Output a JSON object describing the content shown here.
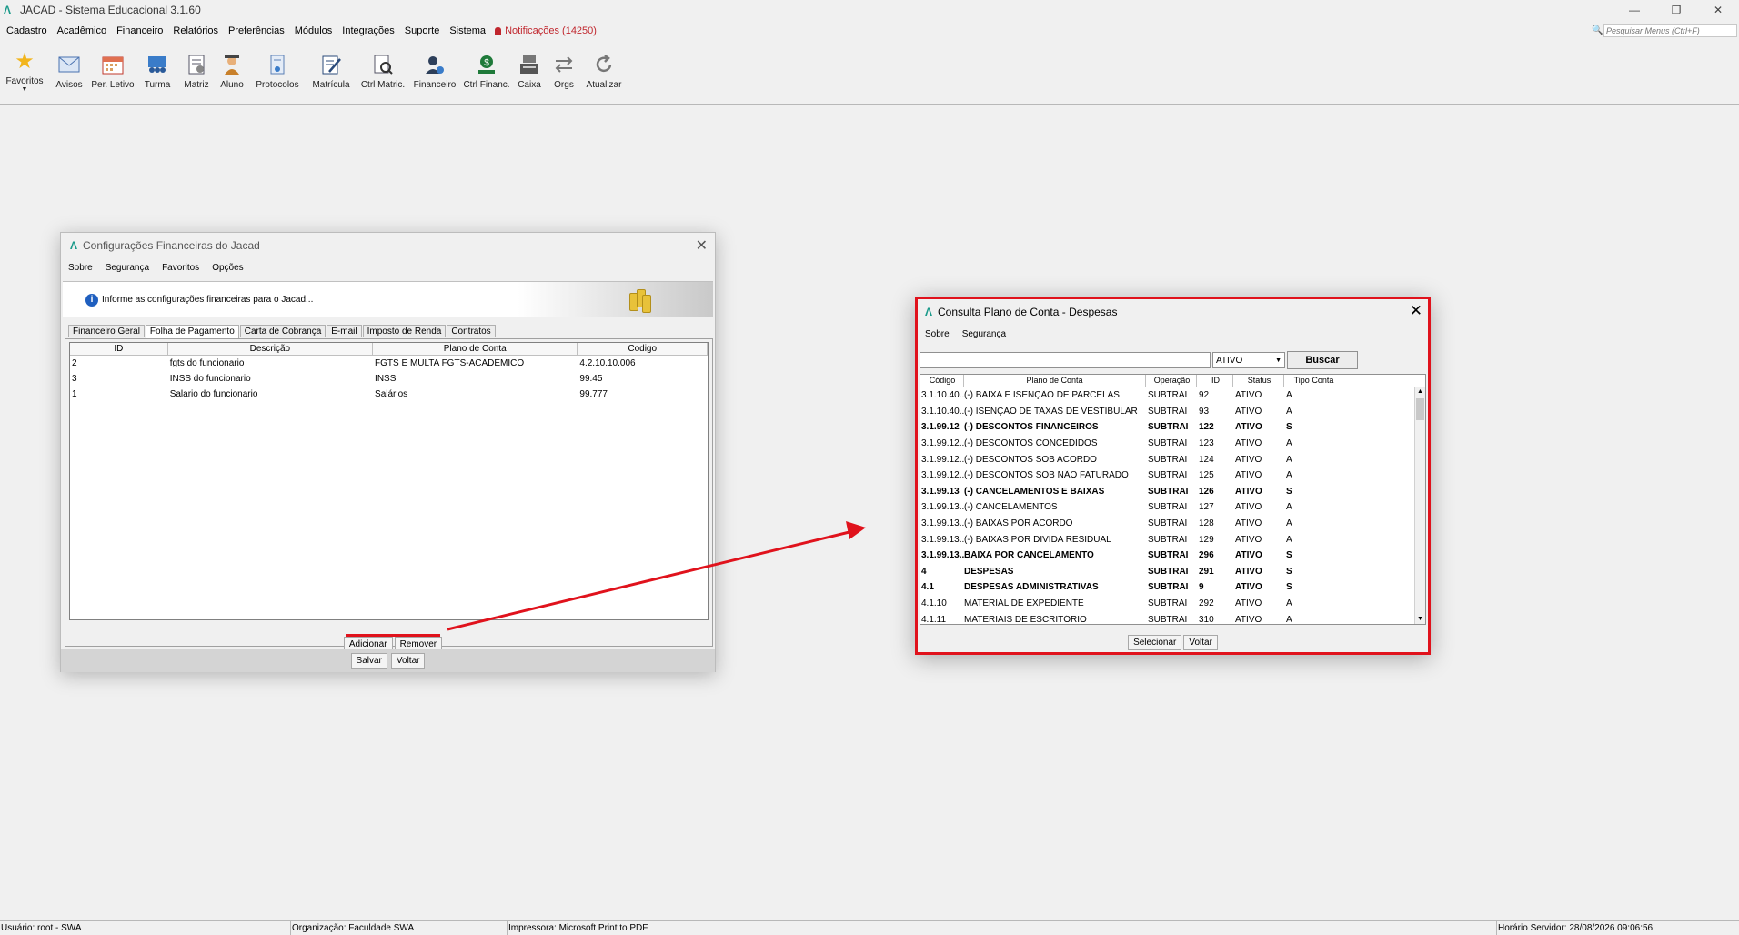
{
  "window": {
    "title": "JACAD - Sistema Educacional 3.1.60"
  },
  "menu": [
    {
      "label": "Cadastro"
    },
    {
      "label": "Acadêmico"
    },
    {
      "label": "Financeiro"
    },
    {
      "label": "Relatórios"
    },
    {
      "label": "Preferências"
    },
    {
      "label": "Módulos"
    },
    {
      "label": "Integrações"
    },
    {
      "label": "Suporte"
    },
    {
      "label": "Sistema"
    }
  ],
  "notifications": "Notificações (14250)",
  "menu_search": {
    "placeholder": "Pesquisar Menus (Ctrl+F)"
  },
  "toolbar": [
    {
      "label": "Favoritos",
      "icon": "star-icon"
    },
    {
      "label": "Avisos",
      "icon": "envelope-icon"
    },
    {
      "label": "Per. Letivo",
      "icon": "calendar-icon"
    },
    {
      "label": "Turma",
      "icon": "class-icon"
    },
    {
      "label": "Matriz",
      "icon": "matrix-icon"
    },
    {
      "label": "Aluno",
      "icon": "student-icon"
    },
    {
      "label": "Protocolos",
      "icon": "protocol-icon"
    },
    {
      "label": "Matrícula",
      "icon": "enrollment-icon"
    },
    {
      "label": "Ctrl Matric.",
      "icon": "enrollment-control-icon"
    },
    {
      "label": "Financeiro",
      "icon": "finance-user-icon"
    },
    {
      "label": "Ctrl Financ.",
      "icon": "finance-control-icon"
    },
    {
      "label": "Caixa",
      "icon": "cash-register-icon"
    },
    {
      "label": "Orgs",
      "icon": "swap-icon"
    },
    {
      "label": "Atualizar",
      "icon": "refresh-icon"
    }
  ],
  "dialog1": {
    "title": "Configurações Financeiras do Jacad",
    "menu": [
      "Sobre",
      "Segurança",
      "Favoritos",
      "Opções"
    ],
    "info": "Informe as configurações financeiras para o Jacad...",
    "tabs": [
      "Financeiro Geral",
      "Folha de Pagamento",
      "Carta de Cobrança",
      "E-mail",
      "Imposto de Renda",
      "Contratos"
    ],
    "columns": [
      "ID",
      "Descrição",
      "Plano de Conta",
      "Codigo"
    ],
    "rows": [
      {
        "id": "2",
        "descricao": "fgts do funcionario",
        "plano": "FGTS E MULTA FGTS-ACADEMICO",
        "codigo": "4.2.10.10.006"
      },
      {
        "id": "3",
        "descricao": "INSS do funcionario",
        "plano": "INSS",
        "codigo": "99.45"
      },
      {
        "id": "1",
        "descricao": "Salario do funcionario",
        "plano": "Salários",
        "codigo": "99.777"
      }
    ],
    "add_label": "Adicionar",
    "remove_label": "Remover",
    "save_label": "Salvar",
    "back_label": "Voltar"
  },
  "dialog2": {
    "title": "Consulta Plano de Conta - Despesas",
    "menu": [
      "Sobre",
      "Segurança"
    ],
    "status_select": "ATIVO",
    "search_label": "Buscar",
    "columns": [
      "Código",
      "Plano de Conta",
      "Operação",
      "ID",
      "Status",
      "Tipo Conta"
    ],
    "rows": [
      {
        "codigo": "3.1.10.40....",
        "plano": "(-) BAIXA E ISENÇÃO DE PARCELAS",
        "op": "SUBTRAI",
        "id": "92",
        "status": "ATIVO",
        "tipo": "A",
        "bold": false
      },
      {
        "codigo": "3.1.10.40....",
        "plano": "(-) ISENÇÃO DE TAXAS DE VESTIBULAR",
        "op": "SUBTRAI",
        "id": "93",
        "status": "ATIVO",
        "tipo": "A",
        "bold": false
      },
      {
        "codigo": "3.1.99.12",
        "plano": "(-) DESCONTOS FINANCEIROS",
        "op": "SUBTRAI",
        "id": "122",
        "status": "ATIVO",
        "tipo": "S",
        "bold": true
      },
      {
        "codigo": "3.1.99.12....",
        "plano": "(-) DESCONTOS CONCEDIDOS",
        "op": "SUBTRAI",
        "id": "123",
        "status": "ATIVO",
        "tipo": "A",
        "bold": false
      },
      {
        "codigo": "3.1.99.12....",
        "plano": "(-) DESCONTOS SOB ACORDO",
        "op": "SUBTRAI",
        "id": "124",
        "status": "ATIVO",
        "tipo": "A",
        "bold": false
      },
      {
        "codigo": "3.1.99.12....",
        "plano": "(-) DESCONTOS SOB NÃO FATURADO",
        "op": "SUBTRAI",
        "id": "125",
        "status": "ATIVO",
        "tipo": "A",
        "bold": false
      },
      {
        "codigo": "3.1.99.13",
        "plano": "(-) CANCELAMENTOS E BAIXAS",
        "op": "SUBTRAI",
        "id": "126",
        "status": "ATIVO",
        "tipo": "S",
        "bold": true
      },
      {
        "codigo": "3.1.99.13....",
        "plano": "(-) CANCELAMENTOS",
        "op": "SUBTRAI",
        "id": "127",
        "status": "ATIVO",
        "tipo": "A",
        "bold": false
      },
      {
        "codigo": "3.1.99.13....",
        "plano": "(-) BAIXAS POR ACORDO",
        "op": "SUBTRAI",
        "id": "128",
        "status": "ATIVO",
        "tipo": "A",
        "bold": false
      },
      {
        "codigo": "3.1.99.13....",
        "plano": "(-) BAIXAS POR DIVIDA RESIDUAL",
        "op": "SUBTRAI",
        "id": "129",
        "status": "ATIVO",
        "tipo": "A",
        "bold": false
      },
      {
        "codigo": "3.1.99.13....",
        "plano": "BAIXA POR CANCELAMENTO",
        "op": "SUBTRAI",
        "id": "296",
        "status": "ATIVO",
        "tipo": "S",
        "bold": true
      },
      {
        "codigo": "4",
        "plano": "DESPESAS",
        "op": "SUBTRAI",
        "id": "291",
        "status": "ATIVO",
        "tipo": "S",
        "bold": true
      },
      {
        "codigo": "4.1",
        "plano": "DESPESAS ADMINISTRATIVAS",
        "op": "SUBTRAI",
        "id": "9",
        "status": "ATIVO",
        "tipo": "S",
        "bold": true
      },
      {
        "codigo": "4.1.10",
        "plano": "MATERIAL DE EXPEDIENTE",
        "op": "SUBTRAI",
        "id": "292",
        "status": "ATIVO",
        "tipo": "A",
        "bold": false
      },
      {
        "codigo": "4.1.11",
        "plano": "MATERIAIS DE ESCRITÓRIO",
        "op": "SUBTRAI",
        "id": "310",
        "status": "ATIVO",
        "tipo": "A",
        "bold": false
      }
    ],
    "select_label": "Selecionar",
    "back_label": "Voltar"
  },
  "statusbar": {
    "user": "Usuário: root - SWA",
    "org": "Organização: Faculdade SWA",
    "printer": "Impressora: Microsoft Print to PDF",
    "server_time": "Horário Servidor: 28/08/2026 09:06:56"
  },
  "colors": {
    "highlight": "#e0121c",
    "logo": "#1a9a8a",
    "notification": "#c0262d"
  }
}
